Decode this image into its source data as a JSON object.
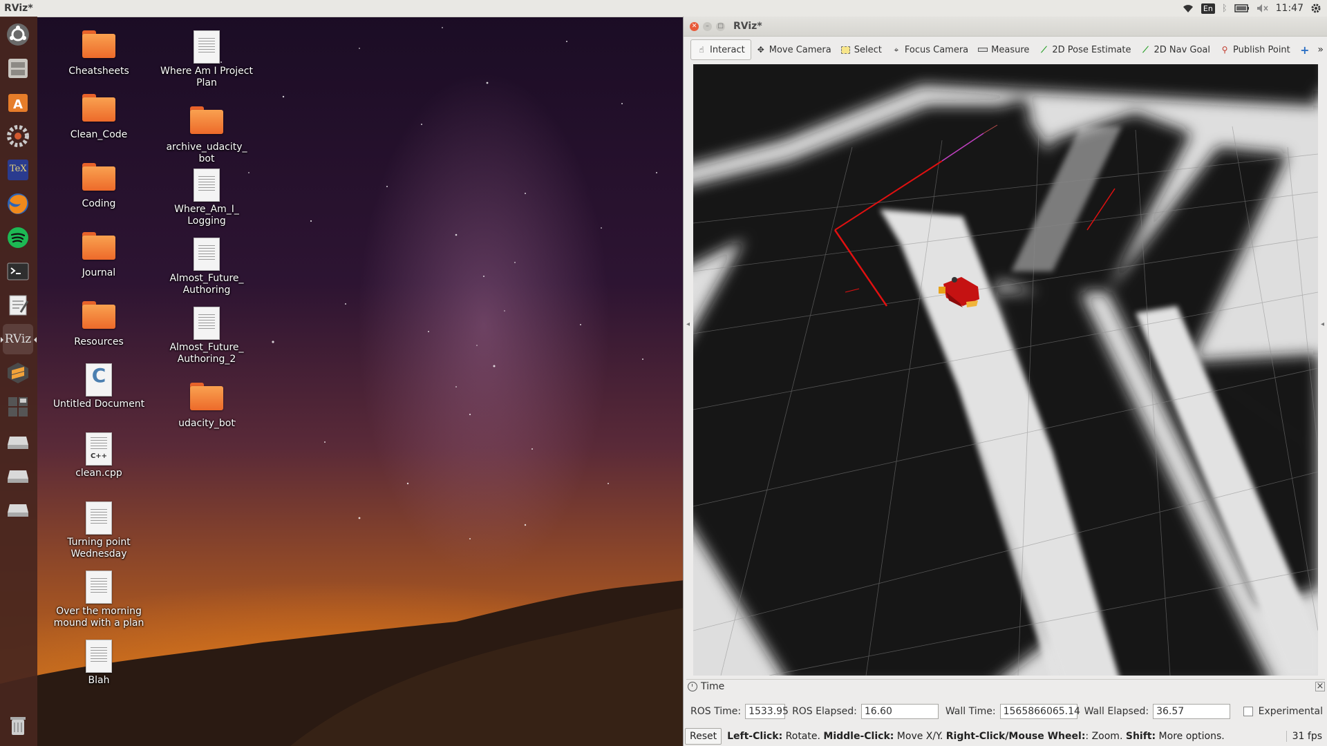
{
  "panel": {
    "app_title": "RViz*",
    "keyboard": "En",
    "clock": "11:47"
  },
  "launcher": {
    "items": [
      "ubuntu-dash",
      "files",
      "software-center",
      "system-settings",
      "texmaker",
      "firefox",
      "spotify",
      "terminal",
      "text-editor",
      "rviz",
      "sublime-text",
      "workspace-switcher",
      "drive-1",
      "drive-2",
      "drive-3",
      "trash"
    ],
    "rviz_label": "RViz",
    "texmaker_label": "TeX"
  },
  "desktop": {
    "col1": [
      "Cheatsheets",
      "Clean_Code",
      "Coding",
      "Journal",
      "Resources",
      "Untitled Document",
      "clean.cpp",
      "Turning point Wednesday",
      "Over the morning mound with a plan",
      "Blah"
    ],
    "col2": [
      "Where Am I Project Plan",
      "archive_udacity_bot",
      "Where_Am_I_Logging",
      "Almost_Future_Authoring",
      "Almost_Future_Authoring_2",
      "udacity_bot"
    ],
    "col1_labels": [
      "Cheatsheets",
      "Clean_Code",
      "Coding",
      "Journal",
      "Resources",
      "Untitled Document",
      "clean.cpp",
      "Turning point\nWednesday",
      "Over the morning\nmound with a plan",
      "Blah"
    ],
    "col2_labels": [
      "Where Am I Project\nPlan",
      "archive_udacity_\nbot",
      "Where_Am_I_\nLogging",
      "Almost_Future_\nAuthoring",
      "Almost_Future_\nAuthoring_2",
      "udacity_bot"
    ],
    "c_glyph": "C",
    "cpp_glyph": "C++"
  },
  "rviz": {
    "title": "RViz*",
    "tools": {
      "interact": "Interact",
      "move_camera": "Move Camera",
      "select": "Select",
      "focus_camera": "Focus Camera",
      "measure": "Measure",
      "pose_estimate": "2D Pose Estimate",
      "nav_goal": "2D Nav Goal",
      "publish_point": "Publish Point",
      "more": "»"
    },
    "time_panel": {
      "title": "Time",
      "ros_time_label": "ROS Time:",
      "ros_time": "1533.95",
      "ros_elapsed_label": "ROS Elapsed:",
      "ros_elapsed": "16.60",
      "wall_time_label": "Wall Time:",
      "wall_time": "1565866065.14",
      "wall_elapsed_label": "Wall Elapsed:",
      "wall_elapsed": "36.57",
      "experimental_label": "Experimental",
      "experimental_checked": false
    },
    "status": {
      "reset": "Reset",
      "left_click": "Left-Click:",
      "left_click_desc": " Rotate. ",
      "middle_click": "Middle-Click:",
      "middle_click_desc": " Move X/Y. ",
      "right_click": "Right-Click/Mouse Wheel:",
      "right_click_desc": ": Zoom. ",
      "shift": "Shift:",
      "shift_desc": " More options.",
      "fps": "31 fps"
    }
  }
}
